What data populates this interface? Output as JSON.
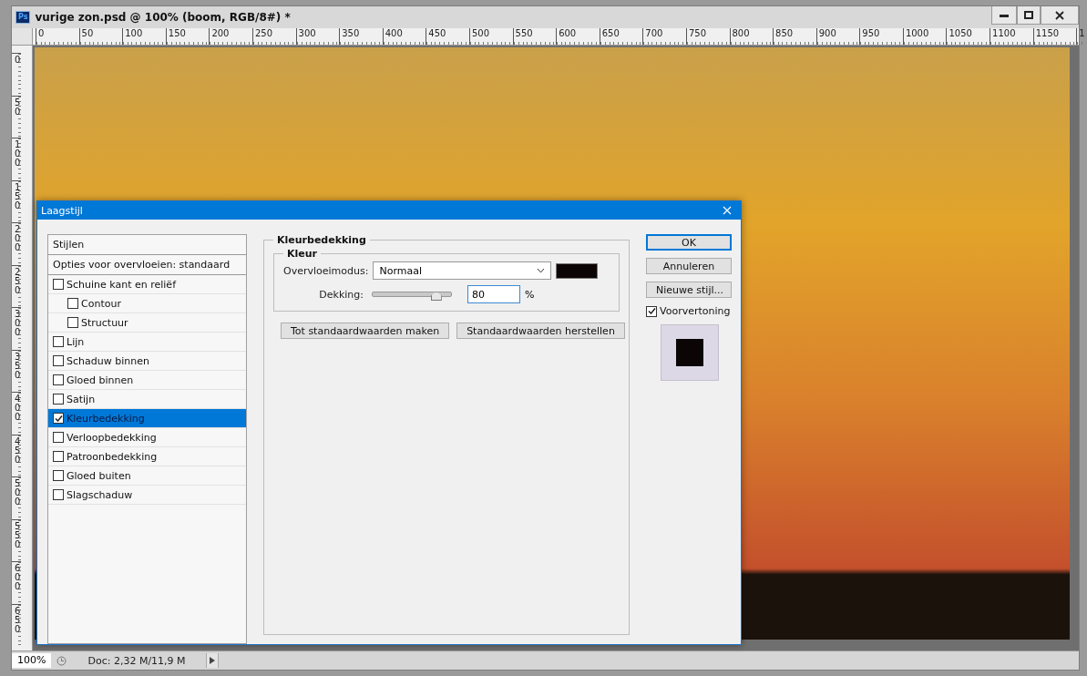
{
  "document": {
    "badge": "Ps",
    "title": "vurige zon.psd @ 100% (boom, RGB/8#) *",
    "ruler_h": [
      "0",
      "50",
      "100",
      "150",
      "200",
      "250",
      "300",
      "350",
      "400",
      "450",
      "500",
      "550",
      "600",
      "650",
      "700",
      "750",
      "800",
      "850",
      "900",
      "950",
      "1000",
      "1050",
      "1100",
      "1150",
      "1"
    ],
    "ruler_v": [
      "0",
      "50",
      "100",
      "150",
      "200",
      "250",
      "300",
      "350",
      "400",
      "450",
      "500",
      "550",
      "600",
      "650"
    ]
  },
  "dialog": {
    "title": "Laagstijl",
    "styles_header": "Stijlen",
    "blending_options": "Opties voor overvloeien: standaard",
    "effects": [
      {
        "label": "Schuine kant en reliëf",
        "checked": false,
        "selected": false,
        "children": [
          {
            "label": "Contour",
            "checked": false,
            "selected": false
          },
          {
            "label": "Structuur",
            "checked": false,
            "selected": false
          }
        ]
      },
      {
        "label": "Lijn",
        "checked": false,
        "selected": false
      },
      {
        "label": "Schaduw binnen",
        "checked": false,
        "selected": false
      },
      {
        "label": "Gloed binnen",
        "checked": false,
        "selected": false
      },
      {
        "label": "Satijn",
        "checked": false,
        "selected": false
      },
      {
        "label": "Kleurbedekking",
        "checked": true,
        "selected": true
      },
      {
        "label": "Verloopbedekking",
        "checked": false,
        "selected": false
      },
      {
        "label": "Patroonbedekking",
        "checked": false,
        "selected": false
      },
      {
        "label": "Gloed buiten",
        "checked": false,
        "selected": false
      },
      {
        "label": "Slagschaduw",
        "checked": false,
        "selected": false
      }
    ],
    "panel": {
      "title": "Kleurbedekking",
      "group": "Kleur",
      "blend_label": "Overvloeimodus:",
      "blend_value": "Normaal",
      "opacity_label": "Dekking:",
      "level": 0.8,
      "opacity_value": "80",
      "unit": "%",
      "buttons": [
        "Tot standaardwaarden maken",
        "Standaardwaarden herstellen"
      ]
    },
    "actions": [
      {
        "label": "OK",
        "default": true
      },
      {
        "label": "Annuleren",
        "default": false
      },
      {
        "label": "Nieuwe stijl...",
        "default": false
      }
    ],
    "preview": {
      "label": "Voorvertoning",
      "checked": true
    }
  },
  "status_bar": {
    "zoom": "100%",
    "doc_info": "Doc: 2,32 M/11,9 M"
  }
}
